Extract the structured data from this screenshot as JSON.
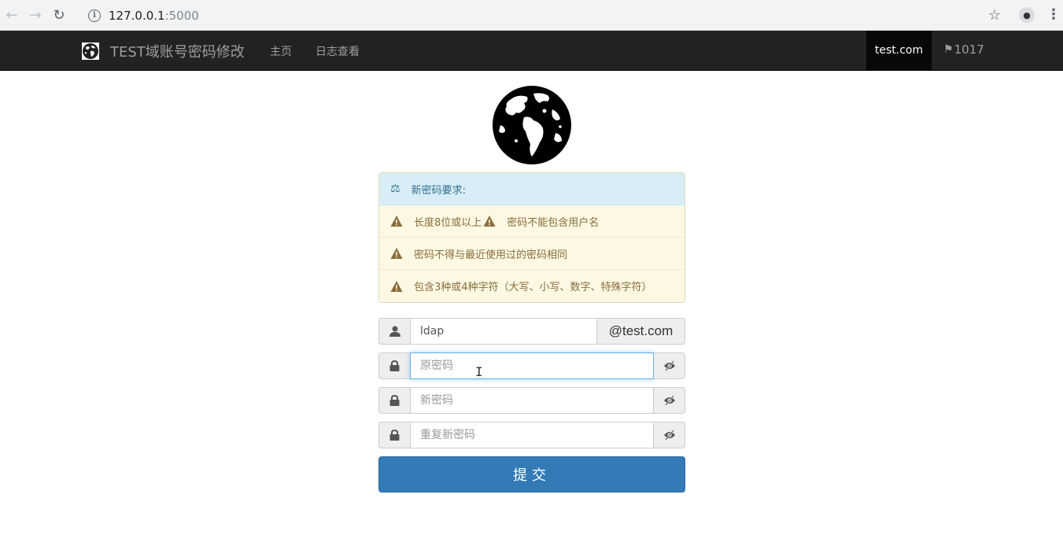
{
  "browser": {
    "url_host": "127.0.0.1",
    "url_port": ":5000",
    "back_icon": "arrow-left",
    "forward_icon": "arrow-right",
    "reload_icon": "reload",
    "bookmark_icon": "star"
  },
  "navbar": {
    "brand": "TEST域账号密码修改",
    "links": [
      "主页",
      "日志查看"
    ],
    "domain": "test.com",
    "count": "1017"
  },
  "requirements": {
    "title": "新密码要求:",
    "items": [
      {
        "a": "长度8位或以上",
        "b": "密码不能包含用户名"
      },
      {
        "a": "密码不得与最近使用过的密码相同"
      },
      {
        "a": "包含3种或4种字符（大写、小写、数字、特殊字符）"
      }
    ]
  },
  "form": {
    "username_value": "ldap",
    "domain_suffix": "@test.com",
    "old_password_placeholder": "原密码",
    "new_password_placeholder": "新密码",
    "repeat_password_placeholder": "重复新密码",
    "submit_label": "提交"
  },
  "colors": {
    "navbar_bg": "#222222",
    "primary": "#337ab7",
    "info_bg": "#d9edf7",
    "warning_bg": "#fcf8e3"
  }
}
